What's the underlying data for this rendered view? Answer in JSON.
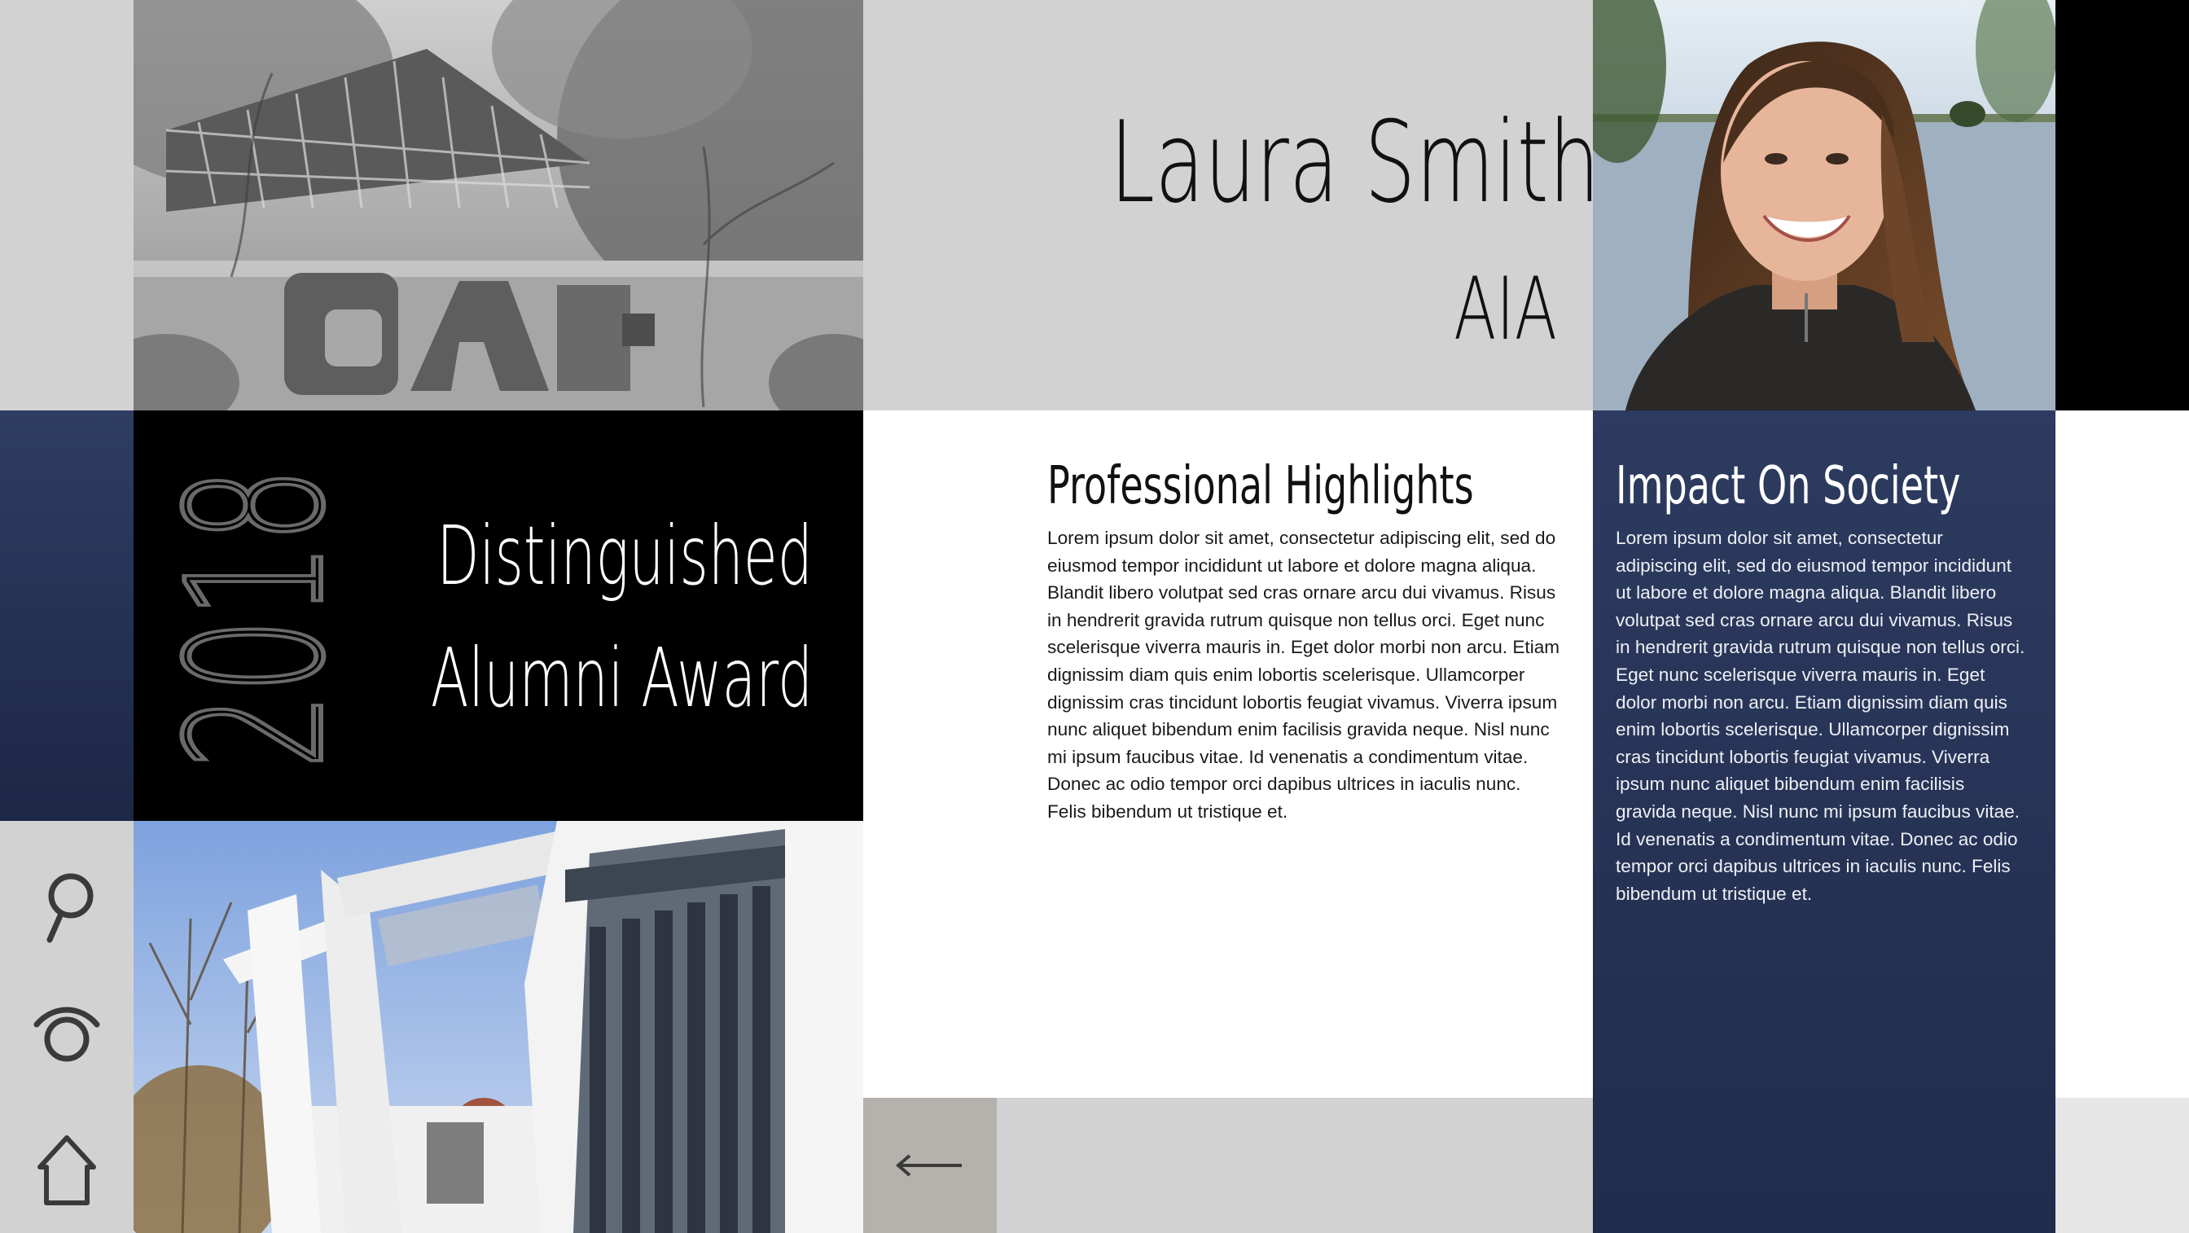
{
  "profile": {
    "name": "Laura Smith",
    "credential": "AIA"
  },
  "award": {
    "year": "2018",
    "line1": "Distinguished",
    "line2": "Alumni Award"
  },
  "highlights": {
    "title": "Professional Highlights",
    "body": "Lorem ipsum dolor sit amet, consectetur adipiscing elit, sed do eiusmod tempor incididunt ut labore et dolore magna aliqua. Blandit libero volutpat sed cras ornare arcu dui vivamus. Risus in hendrerit gravida rutrum quisque non tellus orci. Eget nunc scelerisque viverra mauris in. Eget dolor morbi non arcu. Etiam dignissim diam quis enim lobortis scelerisque. Ullamcorper dignissim cras tincidunt lobortis feugiat vivamus. Viverra ipsum nunc aliquet bibendum enim facilisis gravida neque. Nisl nunc mi ipsum faucibus vitae. Id venenatis a condimentum vitae. Donec ac odio tempor orci dapibus ultrices in iaculis nunc. Felis bibendum ut tristique et."
  },
  "impact": {
    "title": "Impact On Society",
    "body": "Lorem ipsum dolor sit amet, consectetur adipiscing elit, sed do eiusmod tempor incididunt ut labore et dolore magna aliqua. Blandit libero volutpat sed cras ornare arcu dui vivamus. Risus in hendrerit gravida rutrum quisque non tellus orci. Eget nunc scelerisque viverra mauris in. Eget dolor morbi non arcu. Etiam dignissim diam quis enim lobortis scelerisque. Ullamcorper dignissim cras tincidunt lobortis feugiat vivamus. Viverra ipsum nunc aliquet bibendum enim facilisis gravida neque. Nisl nunc mi ipsum faucibus vitae. Id venenatis a condimentum vitae. Donec ac odio tempor orci dapibus ultrices in iaculis nunc. Felis bibendum ut tristique et."
  },
  "nav": {
    "icons": [
      "search-icon",
      "eye-icon",
      "home-icon"
    ],
    "back": "arrow-left-icon"
  },
  "colors": {
    "light_gray": "#d3d2d3",
    "navy": "#2c3a5e",
    "black": "#000000",
    "white": "#ffffff",
    "back_button": "#b5b2ae"
  }
}
